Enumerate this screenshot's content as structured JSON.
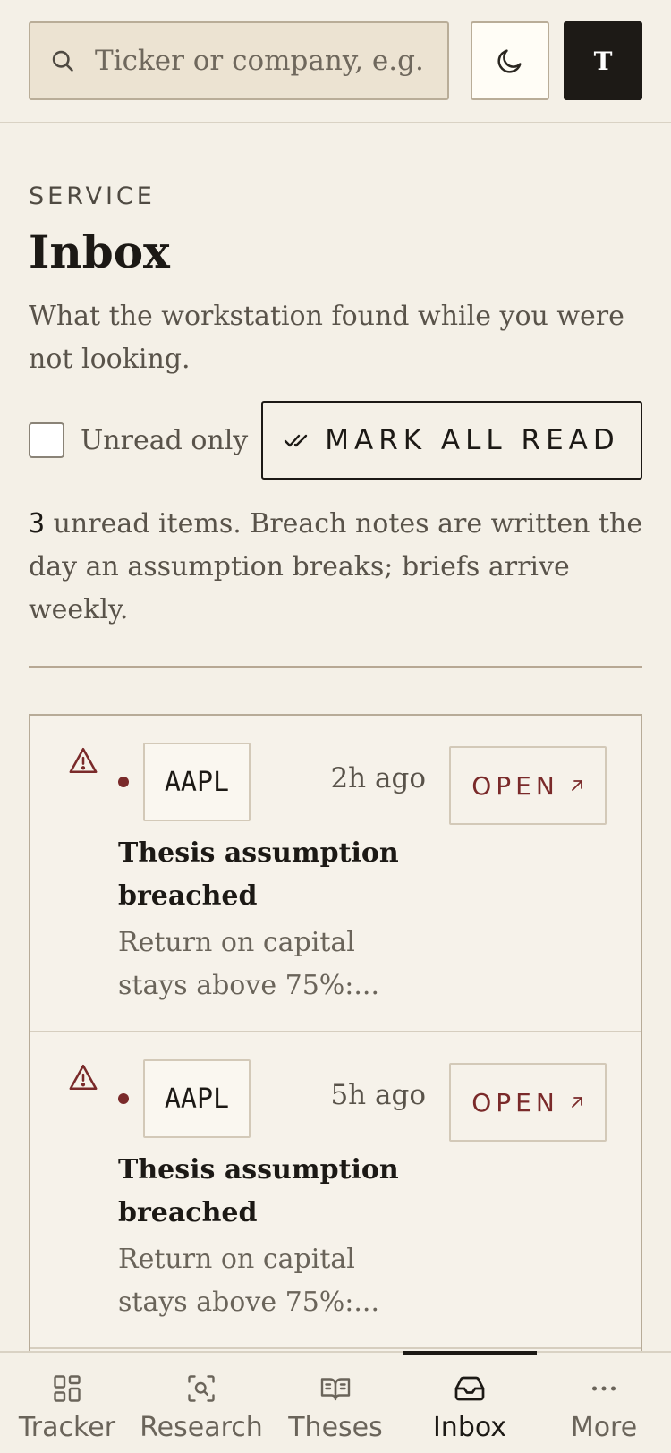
{
  "header": {
    "search_placeholder": "Ticker or company, e.g. AAPL",
    "theme_icon": "moon-icon",
    "avatar_initial": "T"
  },
  "page": {
    "eyebrow": "SERVICE",
    "title": "Inbox",
    "subtitle": "What the workstation found while you were not looking.",
    "unread_only_label": "Unread only",
    "unread_only_checked": false,
    "mark_all_read_label": "MARK ALL READ",
    "summary_count": "3",
    "summary_text": " unread items. Breach notes are written the day an assumption breaks; briefs arrive weekly."
  },
  "inbox": {
    "items": [
      {
        "ticker": "AAPL",
        "time": "2h ago",
        "open_label": "OPEN",
        "headline": "Thesis assumption breached",
        "excerpt": "Return on capital stays above 75%:..."
      },
      {
        "ticker": "AAPL",
        "time": "5h ago",
        "open_label": "OPEN",
        "headline": "Thesis assumption breached",
        "excerpt": "Return on capital stays above 75%:..."
      }
    ]
  },
  "tabs": [
    {
      "label": "Tracker",
      "icon": "grid-icon"
    },
    {
      "label": "Research",
      "icon": "scan-search-icon"
    },
    {
      "label": "Theses",
      "icon": "book-open-icon"
    },
    {
      "label": "Inbox",
      "icon": "inbox-tray-icon",
      "active": true
    },
    {
      "label": "More",
      "icon": "more-dots-icon"
    }
  ],
  "colors": {
    "background": "#f4f0e7",
    "accent": "#7a2a2a",
    "ink": "#1c1915",
    "muted": "#59534a"
  }
}
